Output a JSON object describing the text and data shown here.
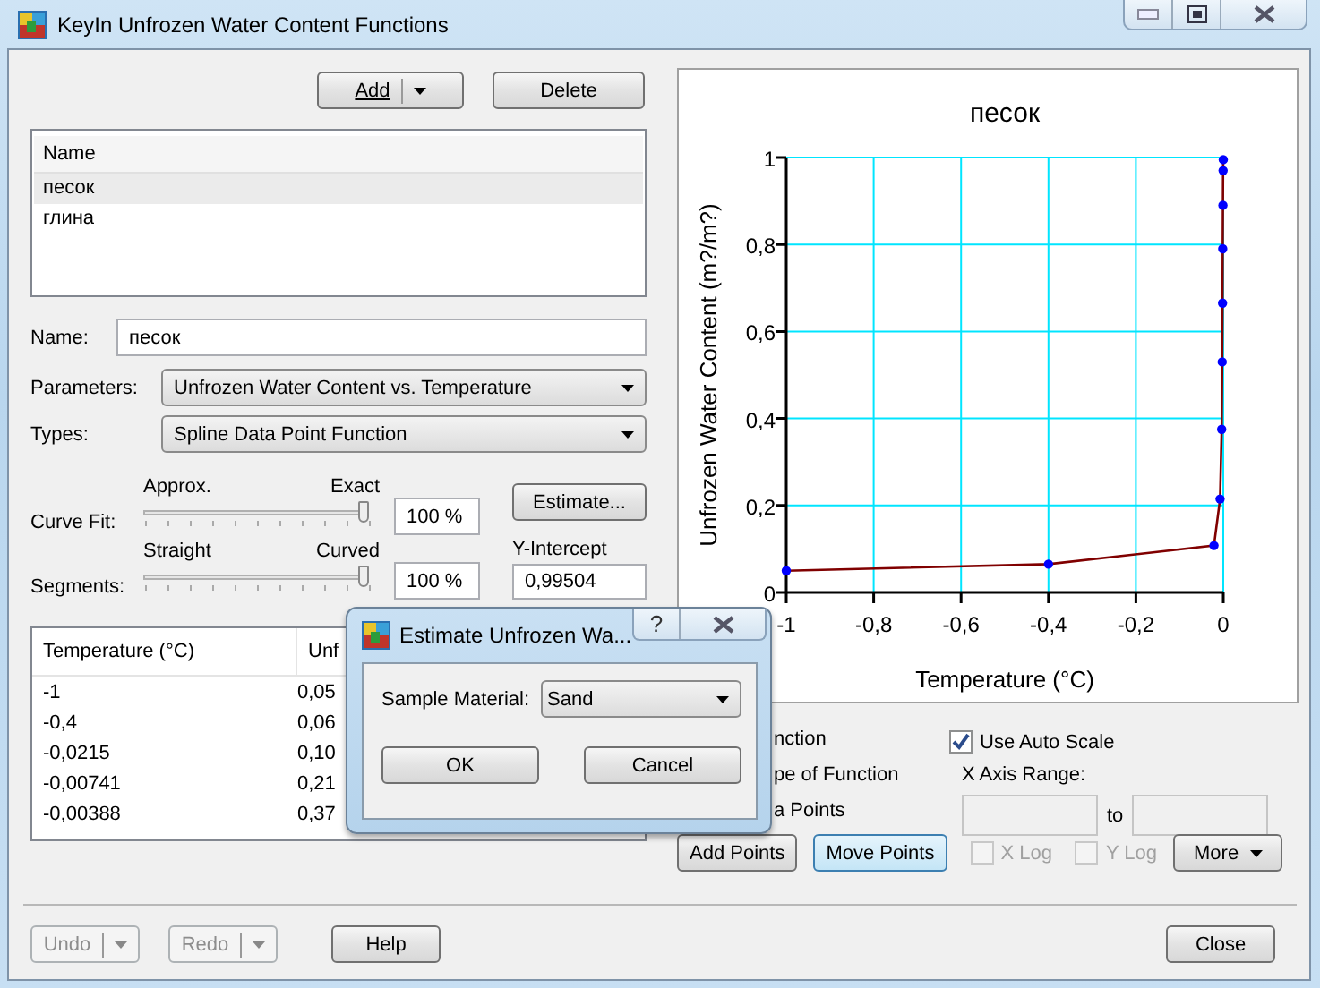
{
  "window": {
    "title": "KeyIn Unfrozen Water Content Functions"
  },
  "toolbar": {
    "add_button": "Add",
    "delete_button": "Delete"
  },
  "functions_list": {
    "header": "Name",
    "items": [
      {
        "label": "песок",
        "selected": true
      },
      {
        "label": "глина",
        "selected": false
      }
    ]
  },
  "form": {
    "name_label": "Name:",
    "name_value": "песок",
    "parameters_label": "Parameters:",
    "parameters_value": "Unfrozen Water Content vs. Temperature",
    "types_label": "Types:",
    "types_value": "Spline Data Point Function"
  },
  "curve_fit": {
    "label": "Curve Fit:",
    "min_label": "Approx.",
    "max_label": "Exact",
    "level": 1,
    "value": "100 %"
  },
  "segments": {
    "label": "Segments:",
    "min_label": "Straight",
    "max_label": "Curved",
    "level": 1,
    "value": "100 %"
  },
  "estimate_button": "Estimate...",
  "y_intercept": {
    "label": "Y-Intercept",
    "value": "0,99504"
  },
  "data_table": {
    "columns": [
      "Temperature (°C)",
      "Unf"
    ],
    "rows": [
      [
        "-1",
        "0,05"
      ],
      [
        "-0,4",
        "0,06"
      ],
      [
        "-0,0215",
        "0,10"
      ],
      [
        "-0,00741",
        "0,21"
      ],
      [
        "-0,00388",
        "0,37"
      ]
    ]
  },
  "chart": {
    "chart_data": {
      "type": "line",
      "title": "песок",
      "xlabel": "Temperature (°C)",
      "ylabel": "Unfrozen Water Content (m?/m?)",
      "x": [
        -1,
        -0.4,
        -0.0215,
        -0.00741,
        -0.00388,
        -0.00257,
        -0.0018,
        -0.0012,
        -0.0008,
        -0.0004,
        0
      ],
      "series": [
        {
          "color": "#800000",
          "marker": true,
          "values": [
            0.05,
            0.065,
            0.108,
            0.215,
            0.375,
            0.53,
            0.665,
            0.79,
            0.89,
            0.97,
            0.995
          ]
        }
      ],
      "xlim": [
        -1,
        0
      ],
      "ylim": [
        0,
        1
      ],
      "grid": true,
      "xticks": [
        {
          "value": -1,
          "label": "-1"
        },
        {
          "value": -0.8,
          "label": "-0,8"
        },
        {
          "value": -0.6,
          "label": "-0,6"
        },
        {
          "value": -0.4,
          "label": "-0,4"
        },
        {
          "value": -0.2,
          "label": "-0,2"
        },
        {
          "value": 0,
          "label": "0"
        }
      ],
      "yticks": [
        {
          "value": 0,
          "label": "0"
        },
        {
          "value": 0.2,
          "label": "0,2"
        },
        {
          "value": 0.4,
          "label": "0,4"
        },
        {
          "value": 0.6,
          "label": "0,6"
        },
        {
          "value": 0.8,
          "label": "0,8"
        },
        {
          "value": 1,
          "label": "1"
        }
      ]
    }
  },
  "plot_options": [
    "nction",
    "pe of Function",
    "a Points"
  ],
  "auto_scale": {
    "label": "Use Auto Scale",
    "checked": true
  },
  "x_axis_range": {
    "label": "X Axis Range:",
    "to_label": "to"
  },
  "tools": [
    {
      "label": "Add Points",
      "selected": false
    },
    {
      "label": "Move Points",
      "selected": true
    }
  ],
  "log_options": [
    {
      "label": "X Log",
      "checked": false,
      "disabled": true
    },
    {
      "label": "Y Log",
      "checked": false,
      "disabled": true
    }
  ],
  "more_button": "More",
  "footer": {
    "undo": {
      "label": "Undo",
      "disabled": true
    },
    "redo": {
      "label": "Redo",
      "disabled": true
    },
    "help": "Help",
    "close": "Close"
  },
  "dialog": {
    "title": "Estimate Unfrozen Wa...",
    "help_button": "?",
    "field_label": "Sample Material:",
    "field_value": "Sand",
    "ok": "OK",
    "cancel": "Cancel"
  }
}
